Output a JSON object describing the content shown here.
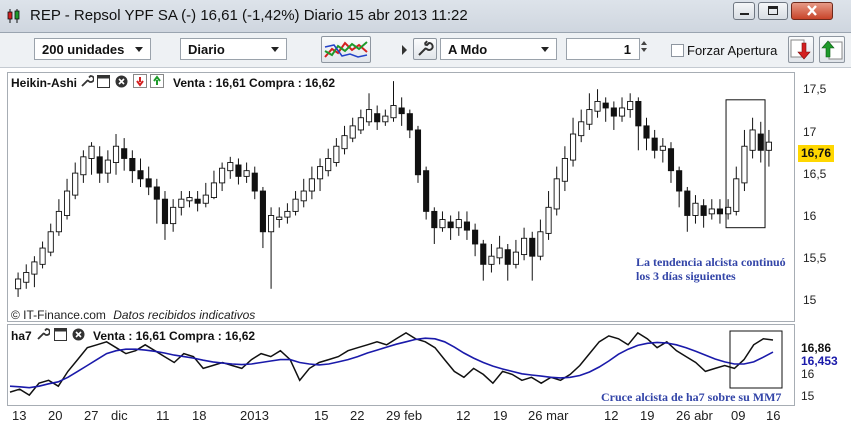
{
  "window": {
    "title": "REP - Repsol YPF SA (-)     16,61 (-1,42%)     Diario  15 abr 2013 11:22"
  },
  "toolbar": {
    "units": "200 unidades",
    "period": "Diario",
    "order_type": "A Mdo",
    "quantity": "1",
    "force_open_label": "Forzar Apertura"
  },
  "price_panel": {
    "indicator": "Heikin-Ashi",
    "quote": "Venta : 16,61 Compra : 16,62",
    "y_ticks": [
      "17,5",
      "17",
      "16,5",
      "16",
      "15,5",
      "15"
    ],
    "current_price": "16,76",
    "attribution": "© IT-Finance.com",
    "notice": "Datos recibidos indicativos",
    "annotation": [
      "La tendencia alcista continuó",
      "los 3 días siguientes"
    ]
  },
  "ha7_panel": {
    "indicator": "ha7",
    "quote": "Venta : 16,61 Compra : 16,62",
    "value_black": "16,86",
    "value_blue": "16,453",
    "y_ticks": [
      "17",
      "16",
      "15"
    ],
    "annotation": "Cruce alcista de ha7 sobre su MM7"
  },
  "x_axis": [
    "13",
    "20",
    "27",
    "dic",
    "11",
    "18",
    "2013",
    "15",
    "22",
    "29 feb",
    "12",
    "19",
    "26 mar",
    "12",
    "19",
    "26 abr",
    "09",
    "16"
  ],
  "colors": {
    "bull": "#ffffff",
    "bear": "#111111",
    "ma": "#1a1aaa",
    "price_tag": "#ffd700",
    "annotation": "#3345a8"
  },
  "chart_data": {
    "type": "candlestick",
    "series_name": "Heikin-Ashi",
    "ylim": [
      14.85,
      17.6
    ],
    "candles": [
      {
        "o": 15.0,
        "c": 15.12,
        "h": 15.2,
        "l": 14.9
      },
      {
        "o": 15.08,
        "c": 15.2,
        "h": 15.3,
        "l": 15.0
      },
      {
        "o": 15.18,
        "c": 15.33,
        "h": 15.4,
        "l": 15.02
      },
      {
        "o": 15.3,
        "c": 15.5,
        "h": 15.58,
        "l": 15.25
      },
      {
        "o": 15.45,
        "c": 15.7,
        "h": 15.8,
        "l": 15.4
      },
      {
        "o": 15.7,
        "c": 15.95,
        "h": 16.1,
        "l": 15.65
      },
      {
        "o": 15.9,
        "c": 16.2,
        "h": 16.35,
        "l": 15.85
      },
      {
        "o": 16.15,
        "c": 16.42,
        "h": 16.55,
        "l": 16.1
      },
      {
        "o": 16.4,
        "c": 16.62,
        "h": 16.7,
        "l": 16.3
      },
      {
        "o": 16.6,
        "c": 16.75,
        "h": 16.8,
        "l": 16.4
      },
      {
        "o": 16.62,
        "c": 16.42,
        "h": 16.75,
        "l": 16.3
      },
      {
        "o": 16.42,
        "c": 16.58,
        "h": 16.7,
        "l": 16.3
      },
      {
        "o": 16.55,
        "c": 16.75,
        "h": 16.9,
        "l": 16.4
      },
      {
        "o": 16.72,
        "c": 16.6,
        "h": 16.85,
        "l": 16.45
      },
      {
        "o": 16.6,
        "c": 16.45,
        "h": 16.7,
        "l": 16.3
      },
      {
        "o": 16.45,
        "c": 16.35,
        "h": 16.6,
        "l": 16.25
      },
      {
        "o": 16.35,
        "c": 16.25,
        "h": 16.5,
        "l": 16.15
      },
      {
        "o": 16.25,
        "c": 16.1,
        "h": 16.35,
        "l": 15.8
      },
      {
        "o": 16.1,
        "c": 15.8,
        "h": 16.2,
        "l": 15.6
      },
      {
        "o": 15.8,
        "c": 16.0,
        "h": 16.1,
        "l": 15.7
      },
      {
        "o": 16.0,
        "c": 16.1,
        "h": 16.2,
        "l": 15.9
      },
      {
        "o": 16.08,
        "c": 16.12,
        "h": 16.2,
        "l": 16.0
      },
      {
        "o": 16.1,
        "c": 16.05,
        "h": 16.2,
        "l": 15.95
      },
      {
        "o": 16.05,
        "c": 16.15,
        "h": 16.3,
        "l": 16.0
      },
      {
        "o": 16.12,
        "c": 16.3,
        "h": 16.45,
        "l": 16.1
      },
      {
        "o": 16.3,
        "c": 16.48,
        "h": 16.55,
        "l": 16.2
      },
      {
        "o": 16.45,
        "c": 16.55,
        "h": 16.62,
        "l": 16.35
      },
      {
        "o": 16.52,
        "c": 16.38,
        "h": 16.6,
        "l": 16.28
      },
      {
        "o": 16.38,
        "c": 16.45,
        "h": 16.55,
        "l": 16.3
      },
      {
        "o": 16.42,
        "c": 16.2,
        "h": 16.5,
        "l": 16.1
      },
      {
        "o": 16.2,
        "c": 15.7,
        "h": 16.25,
        "l": 15.5
      },
      {
        "o": 15.7,
        "c": 15.9,
        "h": 16.0,
        "l": 15.0
      },
      {
        "o": 15.85,
        "c": 15.88,
        "h": 16.0,
        "l": 15.75
      },
      {
        "o": 15.88,
        "c": 15.95,
        "h": 16.05,
        "l": 15.8
      },
      {
        "o": 15.95,
        "c": 16.1,
        "h": 16.2,
        "l": 15.9
      },
      {
        "o": 16.08,
        "c": 16.2,
        "h": 16.35,
        "l": 16.0
      },
      {
        "o": 16.2,
        "c": 16.35,
        "h": 16.5,
        "l": 16.1
      },
      {
        "o": 16.35,
        "c": 16.5,
        "h": 16.6,
        "l": 16.2
      },
      {
        "o": 16.45,
        "c": 16.6,
        "h": 16.72,
        "l": 16.38
      },
      {
        "o": 16.55,
        "c": 16.75,
        "h": 16.85,
        "l": 16.5
      },
      {
        "o": 16.72,
        "c": 16.88,
        "h": 17.0,
        "l": 16.65
      },
      {
        "o": 16.85,
        "c": 17.0,
        "h": 17.1,
        "l": 16.8
      },
      {
        "o": 16.95,
        "c": 17.1,
        "h": 17.2,
        "l": 16.9
      },
      {
        "o": 17.05,
        "c": 17.2,
        "h": 17.4,
        "l": 17.0
      },
      {
        "o": 17.15,
        "c": 17.05,
        "h": 17.25,
        "l": 16.95
      },
      {
        "o": 17.05,
        "c": 17.12,
        "h": 17.2,
        "l": 17.0
      },
      {
        "o": 17.1,
        "c": 17.25,
        "h": 17.55,
        "l": 17.05
      },
      {
        "o": 17.22,
        "c": 17.15,
        "h": 17.35,
        "l": 17.0
      },
      {
        "o": 17.15,
        "c": 16.95,
        "h": 17.2,
        "l": 16.85
      },
      {
        "o": 16.95,
        "c": 16.4,
        "h": 17.0,
        "l": 16.3
      },
      {
        "o": 16.45,
        "c": 15.95,
        "h": 16.5,
        "l": 15.85
      },
      {
        "o": 15.95,
        "c": 15.75,
        "h": 16.0,
        "l": 15.55
      },
      {
        "o": 15.75,
        "c": 15.85,
        "h": 15.95,
        "l": 15.7
      },
      {
        "o": 15.82,
        "c": 15.75,
        "h": 15.9,
        "l": 15.6
      },
      {
        "o": 15.75,
        "c": 15.85,
        "h": 15.95,
        "l": 15.65
      },
      {
        "o": 15.82,
        "c": 15.72,
        "h": 15.95,
        "l": 15.6
      },
      {
        "o": 15.72,
        "c": 15.55,
        "h": 15.8,
        "l": 15.4
      },
      {
        "o": 15.55,
        "c": 15.3,
        "h": 15.6,
        "l": 15.1
      },
      {
        "o": 15.3,
        "c": 15.4,
        "h": 15.55,
        "l": 15.2
      },
      {
        "o": 15.38,
        "c": 15.5,
        "h": 15.65,
        "l": 15.3
      },
      {
        "o": 15.48,
        "c": 15.3,
        "h": 15.55,
        "l": 15.1
      },
      {
        "o": 15.3,
        "c": 15.45,
        "h": 15.6,
        "l": 15.25
      },
      {
        "o": 15.42,
        "c": 15.62,
        "h": 15.75,
        "l": 15.35
      },
      {
        "o": 15.62,
        "c": 15.4,
        "h": 15.7,
        "l": 15.1
      },
      {
        "o": 15.4,
        "c": 15.7,
        "h": 15.85,
        "l": 15.35
      },
      {
        "o": 15.68,
        "c": 16.0,
        "h": 16.2,
        "l": 15.6
      },
      {
        "o": 15.98,
        "c": 16.35,
        "h": 16.5,
        "l": 15.9
      },
      {
        "o": 16.32,
        "c": 16.6,
        "h": 16.75,
        "l": 16.2
      },
      {
        "o": 16.58,
        "c": 16.9,
        "h": 17.1,
        "l": 16.5
      },
      {
        "o": 16.88,
        "c": 17.05,
        "h": 17.2,
        "l": 16.8
      },
      {
        "o": 17.02,
        "c": 17.2,
        "h": 17.4,
        "l": 16.95
      },
      {
        "o": 17.18,
        "c": 17.3,
        "h": 17.45,
        "l": 17.1
      },
      {
        "o": 17.28,
        "c": 17.22,
        "h": 17.35,
        "l": 17.05
      },
      {
        "o": 17.22,
        "c": 17.12,
        "h": 17.3,
        "l": 16.95
      },
      {
        "o": 17.12,
        "c": 17.22,
        "h": 17.35,
        "l": 17.05
      },
      {
        "o": 17.2,
        "c": 17.3,
        "h": 17.4,
        "l": 17.1
      },
      {
        "o": 17.3,
        "c": 17.0,
        "h": 17.35,
        "l": 16.7
      },
      {
        "o": 17.0,
        "c": 16.85,
        "h": 17.1,
        "l": 16.7
      },
      {
        "o": 16.85,
        "c": 16.7,
        "h": 16.95,
        "l": 16.6
      },
      {
        "o": 16.7,
        "c": 16.75,
        "h": 16.85,
        "l": 16.55
      },
      {
        "o": 16.72,
        "c": 16.45,
        "h": 16.8,
        "l": 16.3
      },
      {
        "o": 16.45,
        "c": 16.2,
        "h": 16.5,
        "l": 16.0
      },
      {
        "o": 16.2,
        "c": 15.9,
        "h": 16.25,
        "l": 15.7
      },
      {
        "o": 15.9,
        "c": 16.05,
        "h": 16.15,
        "l": 15.8
      },
      {
        "o": 16.02,
        "c": 15.9,
        "h": 16.1,
        "l": 15.75
      },
      {
        "o": 15.92,
        "c": 15.98,
        "h": 16.1,
        "l": 15.85
      },
      {
        "o": 15.98,
        "c": 15.92,
        "h": 16.1,
        "l": 15.8
      },
      {
        "o": 15.92,
        "c": 16.0,
        "h": 16.1,
        "l": 15.85
      },
      {
        "o": 15.95,
        "c": 16.35,
        "h": 16.5,
        "l": 15.9
      },
      {
        "o": 16.3,
        "c": 16.75,
        "h": 16.95,
        "l": 16.2
      },
      {
        "o": 16.7,
        "c": 16.95,
        "h": 17.1,
        "l": 16.6
      },
      {
        "o": 16.9,
        "c": 16.7,
        "h": 17.05,
        "l": 16.55
      },
      {
        "o": 16.7,
        "c": 16.8,
        "h": 16.95,
        "l": 16.5
      }
    ],
    "ha7_ylim": [
      14.8,
      17.3
    ],
    "ha7": [
      15.1,
      15.2,
      15.0,
      15.4,
      15.5,
      15.3,
      15.8,
      16.2,
      16.6,
      16.7,
      16.8,
      16.6,
      16.4,
      16.5,
      16.7,
      16.5,
      16.3,
      16.1,
      16.4,
      16.3,
      15.9,
      16.0,
      16.1,
      16.0,
      15.9,
      16.2,
      16.4,
      16.3,
      16.5,
      16.2,
      15.5,
      15.9,
      16.1,
      16.2,
      16.3,
      16.5,
      16.6,
      16.7,
      16.8,
      16.7,
      16.9,
      17.1,
      16.9,
      16.8,
      16.6,
      16.2,
      15.8,
      15.6,
      15.9,
      15.7,
      15.4,
      15.8,
      15.7,
      15.5,
      15.6,
      15.4,
      15.6,
      15.5,
      15.7,
      16.0,
      16.4,
      16.8,
      17.0,
      16.9,
      16.7,
      17.1,
      16.9,
      16.6,
      16.8,
      16.5,
      16.3,
      16.1,
      15.8,
      15.9,
      16.0,
      15.9,
      16.2,
      16.7,
      16.9,
      16.86
    ],
    "ha7_ma": [
      15.3,
      15.28,
      15.25,
      15.3,
      15.38,
      15.45,
      15.6,
      15.8,
      16.0,
      16.2,
      16.4,
      16.5,
      16.55,
      16.55,
      16.52,
      16.48,
      16.42,
      16.35,
      16.3,
      16.25,
      16.18,
      16.12,
      16.08,
      16.05,
      16.03,
      16.05,
      16.1,
      16.15,
      16.2,
      16.2,
      16.1,
      16.05,
      16.02,
      16.05,
      16.12,
      16.2,
      16.3,
      16.42,
      16.52,
      16.62,
      16.72,
      16.8,
      16.88,
      16.92,
      16.9,
      16.8,
      16.62,
      16.42,
      16.25,
      16.1,
      15.98,
      15.88,
      15.8,
      15.72,
      15.68,
      15.64,
      15.6,
      15.58,
      15.6,
      15.66,
      15.78,
      15.95,
      16.15,
      16.38,
      16.55,
      16.68,
      16.75,
      16.78,
      16.76,
      16.7,
      16.6,
      16.48,
      16.35,
      16.22,
      16.12,
      16.05,
      16.05,
      16.12,
      16.28,
      16.453
    ]
  }
}
